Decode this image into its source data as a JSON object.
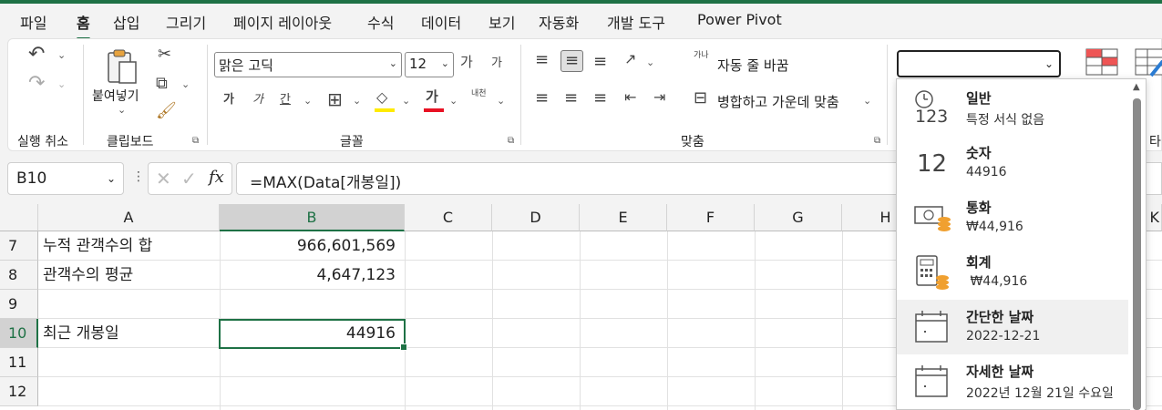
{
  "tabs": [
    "파일",
    "홈",
    "삽입",
    "그리기",
    "페이지 레이아웃",
    "수식",
    "데이터",
    "보기",
    "자동화",
    "개발 도구",
    "Power Pivot"
  ],
  "active_tab": "홈",
  "ribbon": {
    "undo_label": "실행 취소",
    "clipboard_label": "클립보드",
    "paste_label": "붙여넣기",
    "font_label": "글꼴",
    "font_name": "맑은 고딕",
    "font_size": "12",
    "alignment_label": "맞춤",
    "wrap_text": "자동 줄 바꿈",
    "merge_center": "병합하고 가운데 맞춤",
    "partial_label": "타",
    "bold_glyph": "가",
    "italic_glyph": "가",
    "underline_glyph": "간",
    "font_color_glyph": "가",
    "grow_font": "가",
    "shrink_font": "가",
    "phonetic": "내천",
    "wrap_icon_text": "가나",
    "format_value": ""
  },
  "formula_bar": {
    "name_box": "B10",
    "formula": "=MAX(Data[개봉일])",
    "fx": "fx"
  },
  "columns": [
    "A",
    "B",
    "C",
    "D",
    "E",
    "F",
    "G",
    "H",
    "K"
  ],
  "selected_column": "B",
  "rows": [
    {
      "num": "7",
      "a": "누적 관객수의 합",
      "b": "966,601,569"
    },
    {
      "num": "8",
      "a": "관객수의 평균",
      "b": "4,647,123"
    },
    {
      "num": "9",
      "a": "",
      "b": ""
    },
    {
      "num": "10",
      "a": "최근 개봉일",
      "b": "44916"
    },
    {
      "num": "11",
      "a": "",
      "b": ""
    },
    {
      "num": "12",
      "a": "",
      "b": ""
    }
  ],
  "selected_row": "10",
  "number_formats": [
    {
      "title": "일반",
      "sub": "특정 서식 없음",
      "icon": "clock-123-icon",
      "icon_text": "123"
    },
    {
      "title": "숫자",
      "sub": "44916",
      "icon": "number-12-icon",
      "icon_text": "12"
    },
    {
      "title": "통화",
      "sub": "₩44,916",
      "icon": "currency-icon",
      "icon_text": ""
    },
    {
      "title": "회계",
      "sub": " ₩44,916",
      "icon": "accounting-icon",
      "icon_text": ""
    },
    {
      "title": "간단한 날짜",
      "sub": "2022-12-21",
      "icon": "calendar-icon",
      "icon_text": ""
    },
    {
      "title": "자세한 날짜",
      "sub": "2022년 12월 21일 수요일",
      "icon": "calendar-icon",
      "icon_text": ""
    }
  ],
  "colors": {
    "accent": "#1e7145",
    "font_color": "#e81123",
    "fill_color": "#ffeb00"
  }
}
